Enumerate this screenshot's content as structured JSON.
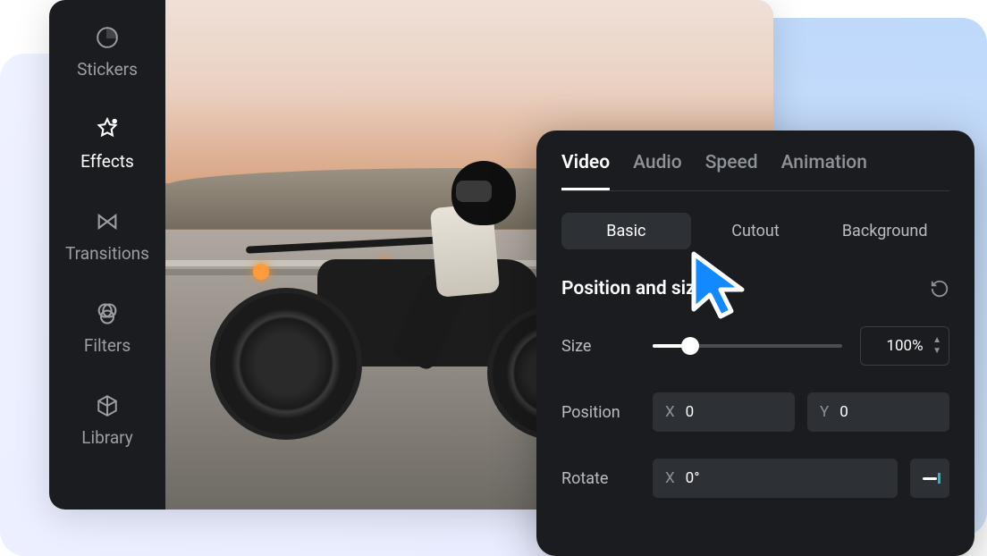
{
  "sidebar": {
    "items": [
      {
        "label": "Stickers"
      },
      {
        "label": "Effects"
      },
      {
        "label": "Transitions"
      },
      {
        "label": "Filters"
      },
      {
        "label": "Library"
      }
    ]
  },
  "panel": {
    "top_tabs": [
      "Video",
      "Audio",
      "Speed",
      "Animation"
    ],
    "sub_tabs": [
      "Basic",
      "Cutout",
      "Background"
    ],
    "section_title": "Position and size",
    "size": {
      "label": "Size",
      "value": "100%"
    },
    "position": {
      "label": "Position",
      "x_axis": "X",
      "x_value": "0",
      "y_axis": "Y",
      "y_value": "0"
    },
    "rotate": {
      "label": "Rotate",
      "x_axis": "X",
      "x_value": "0°"
    }
  }
}
